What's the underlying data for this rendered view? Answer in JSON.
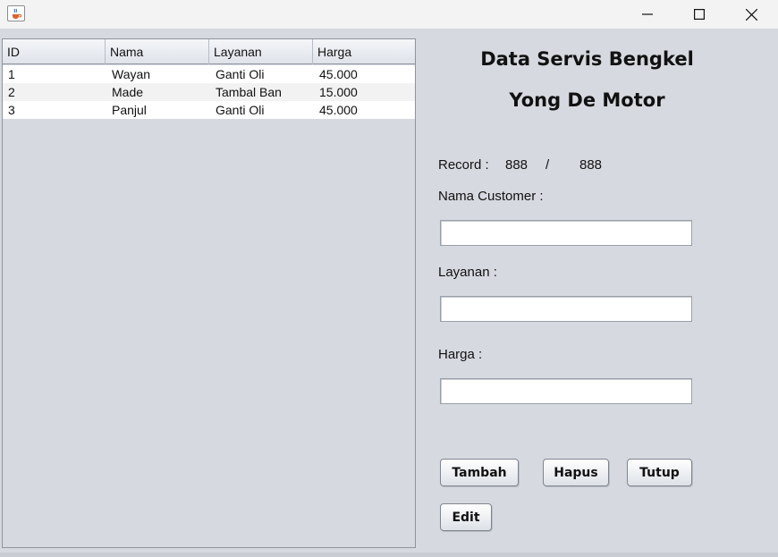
{
  "window": {
    "icons": {
      "app": "java-cup-icon",
      "minimize": "minimize-icon",
      "maximize": "maximize-icon",
      "close": "close-icon"
    }
  },
  "table": {
    "headers": [
      "ID",
      "Nama",
      "Layanan",
      "Harga"
    ],
    "rows": [
      [
        "1",
        "Wayan",
        "Ganti Oli",
        "45.000"
      ],
      [
        "2",
        "Made",
        "Tambal Ban",
        "15.000"
      ],
      [
        "3",
        "Panjul",
        "Ganti Oli",
        "45.000"
      ]
    ]
  },
  "form": {
    "title_line1": "Data Servis Bengkel",
    "title_line2": "Yong De Motor",
    "record_label": "Record :",
    "record_current": "888",
    "record_separator": "/",
    "record_total": "888",
    "nama_label": "Nama Customer :",
    "nama_value": "",
    "layanan_label": "Layanan :",
    "layanan_value": "",
    "harga_label": "Harga :",
    "harga_value": ""
  },
  "buttons": {
    "tambah": "Tambah",
    "hapus": "Hapus",
    "tutup": "Tutup",
    "edit": "Edit"
  },
  "colors": {
    "background": "#d6d9e0",
    "titlebar": "#f3f3f3",
    "row_alt": "#f2f2f2"
  }
}
